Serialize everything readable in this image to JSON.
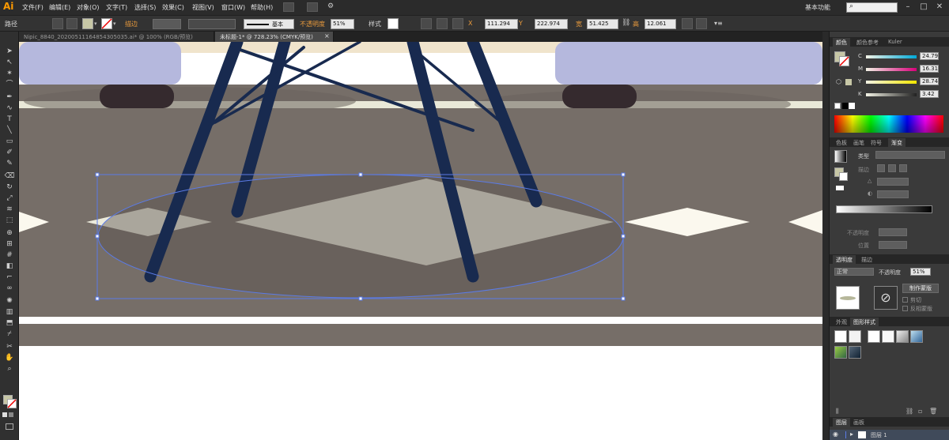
{
  "app": {
    "logo": "Ai"
  },
  "menu": [
    "文件(F)",
    "编辑(E)",
    "对象(O)",
    "文字(T)",
    "选择(S)",
    "效果(C)",
    "视图(V)",
    "窗口(W)",
    "帮助(H)"
  ],
  "workspace": "基本功能",
  "control_bar": {
    "object_type": "路径",
    "stroke_label": "描边",
    "stroke_profile": "基本",
    "opacity_label": "不透明度",
    "opacity_value": "51%",
    "style_label": "样式",
    "x_label": "X",
    "x_value": "111.294",
    "y_label": "Y",
    "y_value": "222.974",
    "w_label": "宽",
    "w_value": "51.425",
    "h_label": "高",
    "h_value": "12.061",
    "fill_color": "#c7c7a6"
  },
  "tabs": [
    {
      "label": "Nipic_8840_20200511164854305035.ai* @ 100% (RGB/预览)",
      "active": false
    },
    {
      "label": "未标题-1* @ 728.23% (CMYK/预览)",
      "active": true
    }
  ],
  "color_panel": {
    "tabs": [
      "颜色",
      "颜色参考",
      "Kuler"
    ],
    "channels": [
      {
        "name": "C",
        "value": "24.79",
        "color": "#00a9d8"
      },
      {
        "name": "M",
        "value": "16.31",
        "color": "#d8007a"
      },
      {
        "name": "Y",
        "value": "28.74",
        "color": "#f2e600"
      },
      {
        "name": "K",
        "value": "3.42",
        "color": "#222222"
      }
    ]
  },
  "gradient_panel": {
    "tabs": [
      "色板",
      "画笔",
      "符号",
      "渐变"
    ],
    "type_label": "类型",
    "stroke_label": "描边",
    "opacity_label": "不透明度",
    "position_label": "位置"
  },
  "transparency_panel": {
    "tabs": [
      "透明度",
      "描边"
    ],
    "mode": "正常",
    "opacity_label": "不透明度",
    "opacity_value": "51%",
    "make_mask": "制作蒙版",
    "clip": "剪切",
    "invert_mask": "反相蒙版"
  },
  "appearance_panel": {
    "tabs": [
      "外观",
      "图形样式"
    ]
  },
  "layers_panel": {
    "tabs": [
      "图层",
      "画板"
    ],
    "layer_name": "图层 1"
  },
  "colors": {
    "floor": "#766e68",
    "rug_light": "#ecebdc",
    "legs": "#182a4f",
    "cushion": "#b5b8dd",
    "wood": "#f0e4cc",
    "feet": "#352a2e",
    "selection": "#5b7be6"
  }
}
